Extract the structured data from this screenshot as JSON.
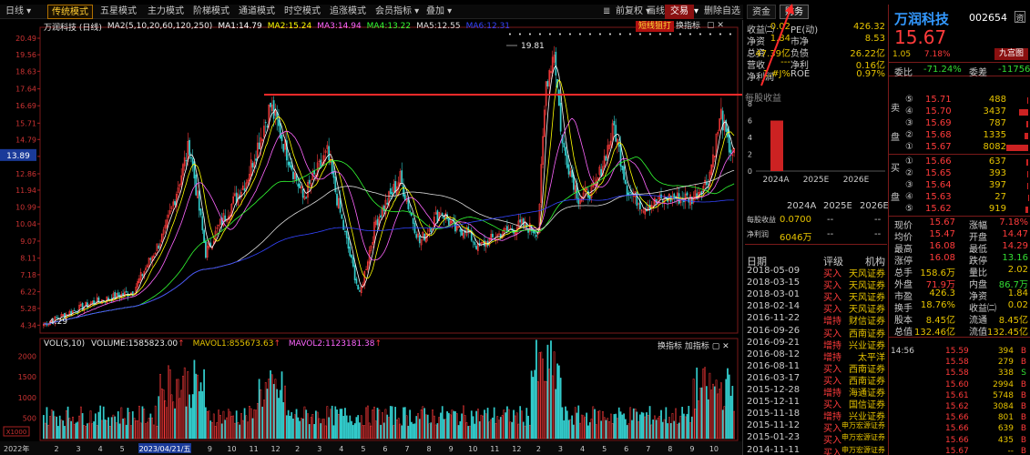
{
  "toolbar": {
    "items": [
      "日线",
      "传统模式",
      "五星模式",
      "主力模式",
      "阶梯模式",
      "通道模式",
      "时空模式",
      "追涨模式",
      "会员指标",
      "叠加"
    ],
    "right": [
      "前复权",
      "画线",
      "交易",
      "删除自选"
    ]
  },
  "main_chart": {
    "title": "万润科技 (日线)",
    "ma_labels": [
      "MA2(5,10,20,60,120,250)",
      "MA1:14.79",
      "MA2:15.24",
      "MA3:14.94",
      "MA4:13.22",
      "MA5:12.55",
      "MA6:12.31"
    ],
    "ma_colors": [
      "#ffffff",
      "#ffff00",
      "#ff66ff",
      "#33ff33",
      "#dddddd",
      "#3344ff"
    ],
    "buttons": [
      "短线狙打",
      "换指标"
    ],
    "y_ticks": [
      "20.49",
      "19.56",
      "18.63",
      "17.64",
      "16.69",
      "15.71",
      "14.79",
      "13.84",
      "12.86",
      "11.94",
      "10.99",
      "10.04",
      "9.07",
      "8.11",
      "7.18",
      "6.22",
      "5.28",
      "4.34"
    ],
    "current_price_label": "13.89",
    "high_label": "19.81",
    "low_label": "4.29",
    "price_range": [
      4.1,
      20.9
    ]
  },
  "vol_chart": {
    "label": "VOL(5,10)",
    "volume": "VOLUME:1585823.00",
    "mavol1": "MAVOL1:855673.63",
    "mavol2": "MAVOL2:1123181.38",
    "buttons": [
      "换指标",
      "加指标"
    ],
    "y_ticks": [
      "2000",
      "1500",
      "1000",
      "500"
    ],
    "unit": "X1000",
    "date_cursor": "2023/04/21/五",
    "year_label": "2022年",
    "x_ticks": [
      "2",
      "3",
      "4",
      "5",
      "6",
      "7",
      "8",
      "9",
      "10",
      "11",
      "12",
      "2",
      "3",
      "4",
      "5",
      "6",
      "7",
      "8",
      "9",
      "10",
      "11",
      "12",
      "2",
      "3",
      "4",
      "5",
      "6",
      "7",
      "8",
      "9",
      "10"
    ]
  },
  "right_tabs": [
    "资金",
    "财务"
  ],
  "finance": [
    {
      "l": "收益㈡",
      "v": "0.02",
      "l2": "PE(动)",
      "v2": "426.32"
    },
    {
      "l": "净资",
      "v": "1.84",
      "l2": "市净",
      "v2": "8.53"
    },
    {
      "l": "总资",
      "v": "47.39亿",
      "l2": "负债",
      "v2": "26.22亿"
    },
    {
      "l": "营收",
      "v": "---",
      "l2": "净利",
      "v2": "0.16亿"
    },
    {
      "l": "净利润",
      "v": "1.#J%",
      "l2": "ROE",
      "v2": "0.97%"
    }
  ],
  "eps_chart": {
    "title": "每股收益",
    "y_ticks": [
      "8",
      "6",
      "4",
      "2",
      "0"
    ],
    "x_labels": [
      "2024A",
      "2025E",
      "2026E"
    ],
    "values": [
      6,
      null,
      null
    ]
  },
  "forecast": {
    "headers": [
      "2024A",
      "2025E",
      "2026E"
    ],
    "rows": [
      {
        "label": "每股收益",
        "vals": [
          "0.0700",
          "--",
          "--"
        ]
      },
      {
        "label": "净利润",
        "vals": [
          "6046万",
          "--",
          "--"
        ]
      }
    ]
  },
  "ratings": {
    "headers": [
      "日期",
      "评级",
      "机构"
    ],
    "rows": [
      [
        "2018-05-09",
        "买入",
        "天风证券"
      ],
      [
        "2018-03-15",
        "买入",
        "天风证券"
      ],
      [
        "2018-03-01",
        "买入",
        "天风证券"
      ],
      [
        "2018-02-14",
        "买入",
        "天风证券"
      ],
      [
        "2016-11-22",
        "增持",
        "财信证券"
      ],
      [
        "2016-09-26",
        "买入",
        "西南证券"
      ],
      [
        "2016-09-21",
        "增持",
        "兴业证券"
      ],
      [
        "2016-08-12",
        "增持",
        "太平洋"
      ],
      [
        "2016-08-11",
        "买入",
        "西南证券"
      ],
      [
        "2016-03-17",
        "买入",
        "西南证券"
      ],
      [
        "2015-12-28",
        "增持",
        "海通证券"
      ],
      [
        "2015-12-11",
        "买入",
        "国信证券"
      ],
      [
        "2015-11-18",
        "增持",
        "兴业证券"
      ],
      [
        "2015-11-12",
        "买入",
        "申万宏源证券"
      ],
      [
        "2015-01-23",
        "买入",
        "申万宏源证券"
      ],
      [
        "2014-11-11",
        "买入",
        "申万宏源证券"
      ]
    ]
  },
  "quote": {
    "name": "万润科技",
    "code": "002654",
    "price": "15.67",
    "change": "1.05",
    "change_pct": "7.18%",
    "board": "九宫图",
    "weibi_label": "委比",
    "weibi": "-71.24%",
    "weicha_label": "委差",
    "weicha": "-11756"
  },
  "orderbook": {
    "sell": [
      {
        "n": "⑤",
        "p": "15.71",
        "v": "488"
      },
      {
        "n": "④",
        "p": "15.70",
        "v": "3437"
      },
      {
        "n": "③",
        "p": "15.69",
        "v": "787"
      },
      {
        "n": "②",
        "p": "15.68",
        "v": "1335"
      },
      {
        "n": "①",
        "p": "15.67",
        "v": "8082"
      }
    ],
    "buy": [
      {
        "n": "①",
        "p": "15.66",
        "v": "637"
      },
      {
        "n": "②",
        "p": "15.65",
        "v": "393"
      },
      {
        "n": "③",
        "p": "15.64",
        "v": "397"
      },
      {
        "n": "④",
        "p": "15.63",
        "v": "27"
      },
      {
        "n": "⑤",
        "p": "15.62",
        "v": "919"
      }
    ],
    "sell_side": [
      "卖",
      "盘"
    ],
    "buy_side": [
      "买",
      "盘"
    ]
  },
  "stats": [
    [
      "现价",
      "15.67",
      "涨幅",
      "7.18%"
    ],
    [
      "均价",
      "15.47",
      "开盘",
      "14.47"
    ],
    [
      "最高",
      "16.08",
      "最低",
      "14.29"
    ],
    [
      "涨停",
      "16.08",
      "跌停",
      "13.16"
    ],
    [
      "总手",
      "158.6万",
      "量比",
      "2.02"
    ],
    [
      "外盘",
      "71.9万",
      "内盘",
      "86.7万"
    ],
    [
      "市盈",
      "426.3",
      "净资",
      "1.84"
    ],
    [
      "换手",
      "18.76%",
      "收益㈡",
      "0.02"
    ],
    [
      "股本",
      "8.45亿",
      "流通",
      "8.45亿"
    ],
    [
      "总值",
      "132.46亿",
      "流值",
      "132.45亿"
    ]
  ],
  "ticks": {
    "time": "14:56",
    "rows": [
      [
        "15.59",
        "394",
        "B"
      ],
      [
        "15.58",
        "279",
        "B"
      ],
      [
        "15.58",
        "338",
        "S"
      ],
      [
        "15.60",
        "2994",
        "B"
      ],
      [
        "15.61",
        "5748",
        "B"
      ],
      [
        "15.62",
        "3084",
        "B"
      ],
      [
        "15.66",
        "801",
        "B"
      ],
      [
        "15.66",
        "639",
        "B"
      ],
      [
        "15.66",
        "435",
        "B"
      ],
      [
        "15.67",
        "--",
        "B"
      ]
    ]
  },
  "colors": {
    "up": "#ff3b3b",
    "down": "#33dd33",
    "accent": "#e6c300",
    "arrow": "#ff2a2a"
  }
}
